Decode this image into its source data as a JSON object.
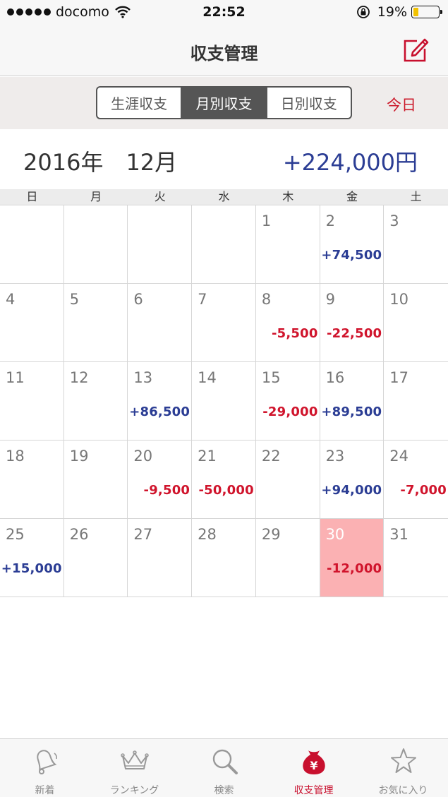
{
  "status_bar": {
    "carrier": "docomo",
    "time": "22:52",
    "battery": "19%"
  },
  "nav": {
    "title": "収支管理"
  },
  "segments": [
    {
      "label": "生涯収支",
      "active": false
    },
    {
      "label": "月別収支",
      "active": true
    },
    {
      "label": "日別収支",
      "active": false
    }
  ],
  "today_label": "今日",
  "month": {
    "label": "2016年　12月",
    "total": "+224,000円"
  },
  "weekdays": [
    "日",
    "月",
    "火",
    "水",
    "木",
    "金",
    "土"
  ],
  "calendar": [
    [
      "",
      ""
    ],
    [
      "",
      ""
    ],
    [
      "",
      ""
    ],
    [
      "",
      ""
    ],
    [
      "1",
      ""
    ],
    [
      "2",
      "+74,500"
    ],
    [
      "3",
      ""
    ],
    [
      "4",
      ""
    ],
    [
      "5",
      ""
    ],
    [
      "6",
      ""
    ],
    [
      "7",
      ""
    ],
    [
      "8",
      "-5,500"
    ],
    [
      "9",
      "-22,500"
    ],
    [
      "10",
      ""
    ],
    [
      "11",
      ""
    ],
    [
      "12",
      ""
    ],
    [
      "13",
      "+86,500"
    ],
    [
      "14",
      ""
    ],
    [
      "15",
      "-29,000"
    ],
    [
      "16",
      "+89,500"
    ],
    [
      "17",
      ""
    ],
    [
      "18",
      ""
    ],
    [
      "19",
      ""
    ],
    [
      "20",
      "-9,500"
    ],
    [
      "21",
      "-50,000"
    ],
    [
      "22",
      ""
    ],
    [
      "23",
      "+94,000"
    ],
    [
      "24",
      "-7,000"
    ],
    [
      "25",
      "+15,000"
    ],
    [
      "26",
      ""
    ],
    [
      "27",
      ""
    ],
    [
      "28",
      ""
    ],
    [
      "29",
      ""
    ],
    [
      "30",
      "-12,000"
    ],
    [
      "31",
      ""
    ]
  ],
  "today_day": "30",
  "colors": {
    "positive": "#2b3d94",
    "negative": "#d0142c",
    "accent": "#c8102e",
    "today_bg": "#fbb1b3"
  },
  "tabs": [
    {
      "label": "新着",
      "icon": "bell-icon",
      "active": false
    },
    {
      "label": "ランキング",
      "icon": "crown-icon",
      "active": false
    },
    {
      "label": "検索",
      "icon": "search-icon",
      "active": false
    },
    {
      "label": "収支管理",
      "icon": "yen-bag-icon",
      "active": true
    },
    {
      "label": "お気に入り",
      "icon": "star-icon",
      "active": false
    }
  ]
}
